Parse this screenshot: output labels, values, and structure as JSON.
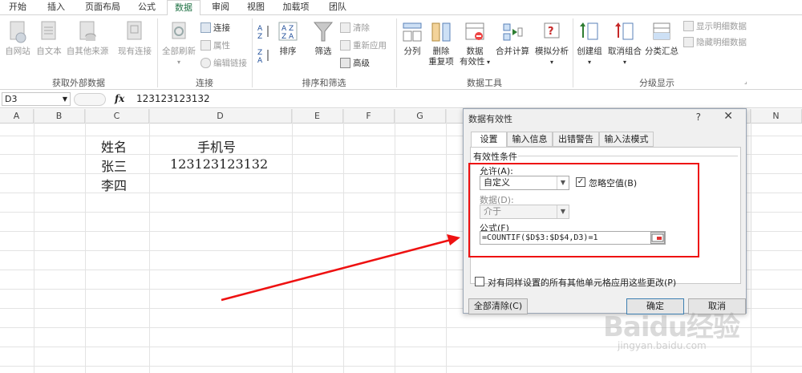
{
  "tabs": [
    "开始",
    "插入",
    "页面布局",
    "公式",
    "数据",
    "审阅",
    "视图",
    "加载项",
    "团队"
  ],
  "ribbon": {
    "groups": {
      "external": "获取外部数据",
      "connections": "连接",
      "sort_filter": "排序和筛选",
      "data_tools": "数据工具",
      "outline": "分级显示"
    },
    "external": [
      "自网站",
      "自文本",
      "自其他来源",
      "现有连接"
    ],
    "refresh_all": "全部刷新",
    "connections_small": [
      "连接",
      "属性",
      "编辑链接"
    ],
    "sort": "排序",
    "filter": "筛选",
    "filter_small": [
      "清除",
      "重新应用",
      "高级"
    ],
    "text_to_columns": "分列",
    "remove_duplicates_1": "删除",
    "remove_duplicates_2": "重复项",
    "validation_1": "数据",
    "validation_2": "有效性",
    "consolidate": "合并计算",
    "what_if": "模拟分析",
    "group": "创建组",
    "ungroup": "取消组合",
    "subtotal": "分类汇总",
    "show_detail": "显示明细数据",
    "hide_detail": "隐藏明细数据"
  },
  "formula_bar": {
    "name_box": "D3",
    "fx": "fx",
    "value": "123123123132"
  },
  "columns": [
    "A",
    "B",
    "C",
    "D",
    "E",
    "F",
    "G",
    "N"
  ],
  "cells": {
    "c1": "姓名",
    "d1": "手机号",
    "c2": "张三",
    "d2": "123123123132",
    "c3": "李四"
  },
  "dialog": {
    "title": "数据有效性",
    "help": "?",
    "close": "✕",
    "tabs": [
      "设置",
      "输入信息",
      "出错警告",
      "输入法模式"
    ],
    "criteria_label": "有效性条件",
    "allow_label": "允许(A):",
    "allow_value": "自定义",
    "ignore_blank": "忽略空值(B)",
    "data_label": "数据(D):",
    "data_value": "介于",
    "formula_label": "公式(F)",
    "formula_value": "=COUNTIF($D$3:$D$4,D3)=1",
    "apply_all": "对有同样设置的所有其他单元格应用这些更改(P)",
    "clear_all": "全部清除(C)",
    "ok": "确定",
    "cancel": "取消"
  },
  "watermark": {
    "brand": "Baidu经验",
    "url": "jingyan.baidu.com"
  },
  "colors": {
    "accent": "#217346",
    "highlight": "#ee1111"
  }
}
